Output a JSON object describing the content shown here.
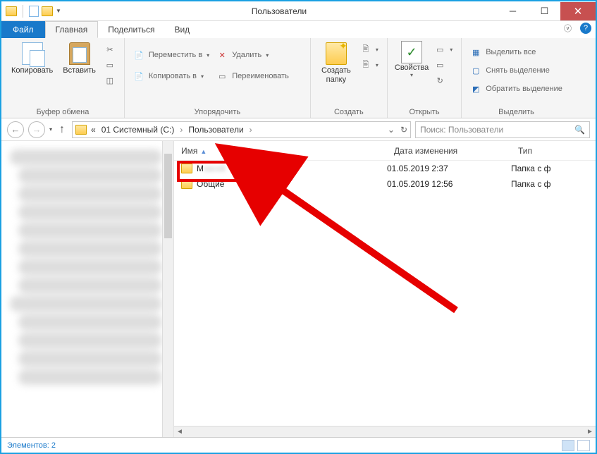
{
  "window": {
    "title": "Пользователи"
  },
  "tabs": {
    "file": "Файл",
    "home": "Главная",
    "share": "Поделиться",
    "view": "Вид"
  },
  "ribbon": {
    "clipboard": {
      "label": "Буфер обмена",
      "copy": "Копировать",
      "paste": "Вставить"
    },
    "organize": {
      "label": "Упорядочить",
      "moveto": "Переместить в",
      "copyto": "Копировать в",
      "delete": "Удалить",
      "rename": "Переименовать"
    },
    "new": {
      "label": "Создать",
      "newfolder": "Создать\nпапку"
    },
    "open": {
      "label": "Открыть",
      "properties": "Свойства"
    },
    "select": {
      "label": "Выделить",
      "selectall": "Выделить все",
      "selectnone": "Снять выделение",
      "invert": "Обратить выделение"
    }
  },
  "breadcrumbs": {
    "prefix": "«",
    "drive": "01 Системный (C:)",
    "folder": "Пользователи"
  },
  "search": {
    "placeholder": "Поиск: Пользователи"
  },
  "columns": {
    "name": "Имя",
    "date": "Дата изменения",
    "type": "Тип"
  },
  "items": [
    {
      "name": "M",
      "redacted": "евгей",
      "date": "01.05.2019 2:37",
      "type": "Папка с ф"
    },
    {
      "name": "Общие",
      "date": "01.05.2019 12:56",
      "type": "Папка с ф"
    }
  ],
  "status": {
    "text": "Элементов: 2"
  }
}
